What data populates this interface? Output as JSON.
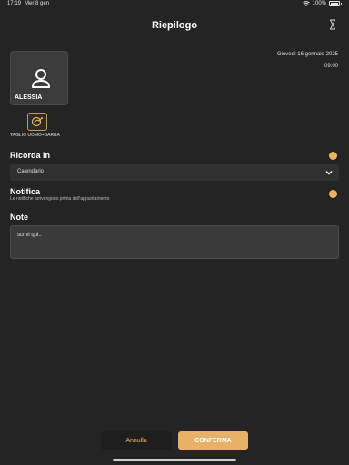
{
  "status": {
    "time": "17:19",
    "date": "Mer 8 gen",
    "battery": "100%"
  },
  "header": {
    "title": "Riepilogo"
  },
  "appointment": {
    "date": "Giovedì 16 gennaio 2025",
    "time": "09:00"
  },
  "profile": {
    "name": "ALESSIA",
    "icon": "person-icon"
  },
  "service": {
    "name": "TAGLIO UOMO+BARBA",
    "icon": "barber-icon"
  },
  "remind": {
    "label": "Ricorda in",
    "enabled": true,
    "select_value": "Calendario"
  },
  "notify": {
    "label": "Notifica",
    "description": "Le notifiche arrivengono prima dell'appuntamento",
    "enabled": true
  },
  "notes": {
    "label": "Note",
    "placeholder": "scrivi qui.."
  },
  "actions": {
    "cancel": "Annulla",
    "confirm": "CONFERMA"
  },
  "colors": {
    "accent": "#e9b168",
    "background": "#242424",
    "card": "#3b3b3b"
  }
}
